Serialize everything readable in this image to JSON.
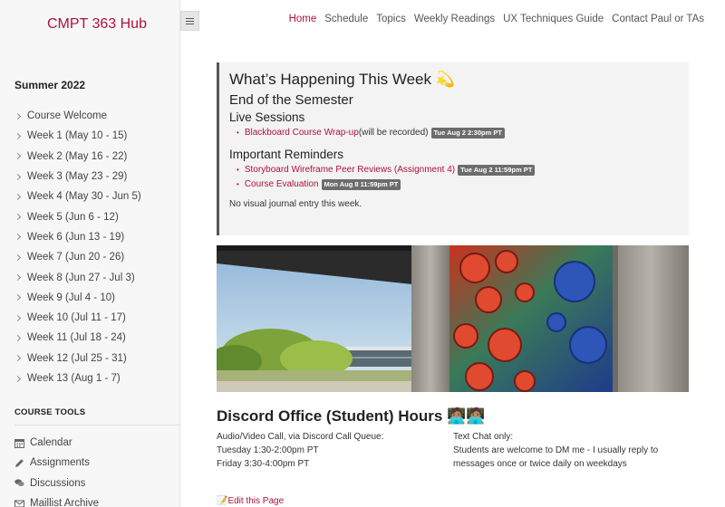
{
  "site": {
    "title": "CMPT 363 Hub"
  },
  "sidebar": {
    "term": "Summer 2022",
    "items": [
      {
        "label": "Course Welcome"
      },
      {
        "label": "Week 1 (May 10 - 15)"
      },
      {
        "label": "Week 2 (May 16 - 22)"
      },
      {
        "label": "Week 3 (May 23 - 29)"
      },
      {
        "label": "Week 4 (May 30 - Jun 5)"
      },
      {
        "label": "Week 5 (Jun 6 - 12)"
      },
      {
        "label": "Week 6 (Jun 13 - 19)"
      },
      {
        "label": "Week 7 (Jun 20 - 26)"
      },
      {
        "label": "Week 8 (Jun 27 - Jul 3)"
      },
      {
        "label": "Week 9 (Jul 4 - 10)"
      },
      {
        "label": "Week 10 (Jul 11 - 17)"
      },
      {
        "label": "Week 11 (Jul 18 - 24)"
      },
      {
        "label": "Week 12 (Jul 25 - 31)"
      },
      {
        "label": "Week 13 (Aug 1 - 7)"
      }
    ],
    "tools_heading": "COURSE TOOLS",
    "tools": [
      {
        "label": "Calendar",
        "icon": "calendar-icon"
      },
      {
        "label": "Assignments",
        "icon": "pencil-icon"
      },
      {
        "label": "Discussions",
        "icon": "comments-icon"
      },
      {
        "label": "Maillist Archive",
        "icon": "envelope-icon"
      }
    ]
  },
  "nav": {
    "links": [
      {
        "label": "Home",
        "active": true
      },
      {
        "label": "Schedule"
      },
      {
        "label": "Topics"
      },
      {
        "label": "Weekly Readings"
      },
      {
        "label": "UX Techniques Guide"
      },
      {
        "label": "Contact Paul or TAs"
      }
    ]
  },
  "week": {
    "title": "What’s Happening This Week 💫",
    "subtitle": "End of the Semester",
    "live_heading": "Live Sessions",
    "live": [
      {
        "link": "Blackboard Course Wrap-up",
        "suffix": " (will be recorded)",
        "badge": "Tue Aug 2 2:30pm PT"
      }
    ],
    "reminders_heading": "Important Reminders",
    "reminders": [
      {
        "link": "Storyboard Wireframe Peer Reviews (Assignment 4)",
        "badge": "Tue Aug 2 11:59pm PT"
      },
      {
        "link": "Course Evaluation",
        "badge": "Mon Aug 8 11:59pm PT"
      }
    ],
    "note": "No visual journal entry this week."
  },
  "office_hours": {
    "title": "Discord Office (Student) Hours 🧑🏽‍💻🧑🏽‍💻",
    "left": [
      "Audio/Video Call, via Discord Call Queue:",
      "Tuesday 1:30-2:00pm PT",
      "Friday 3:30-4:00pm PT"
    ],
    "right": [
      "Text Chat only:",
      "Students are welcome to DM me - I usually reply to messages once or twice daily on weekdays"
    ]
  },
  "footer": {
    "edit": "📝Edit this Page"
  },
  "colors": {
    "accent": "#b0113a",
    "badge": "#6c6c6c"
  }
}
